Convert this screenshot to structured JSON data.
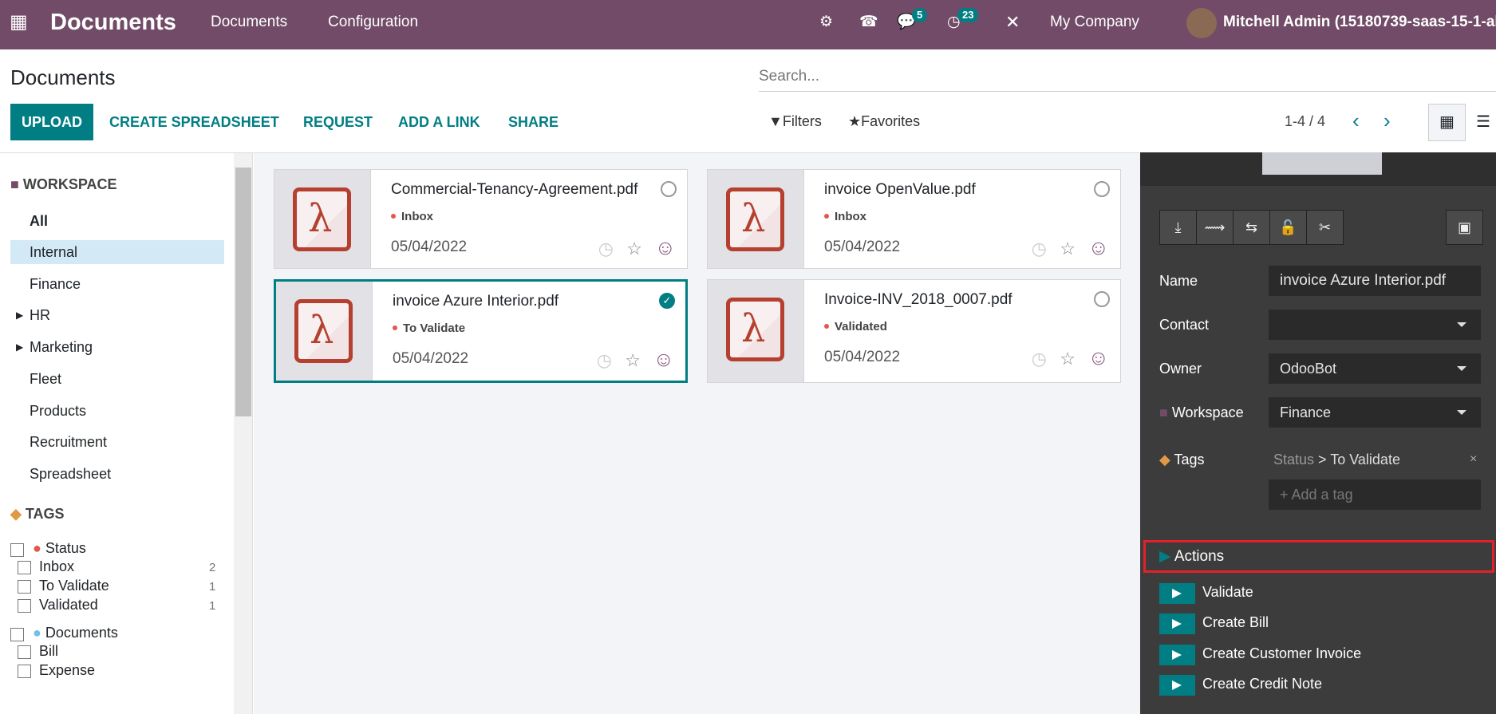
{
  "navbar": {
    "app_title": "Documents",
    "menu": [
      "Documents",
      "Configuration"
    ],
    "chat_count": "5",
    "activity_count": "23",
    "company": "My Company",
    "user": "Mitchell Admin (15180739-saas-15-1-al"
  },
  "control": {
    "title": "Documents",
    "search_placeholder": "Search...",
    "buttons": {
      "upload": "UPLOAD",
      "spreadsheet": "CREATE SPREADSHEET",
      "request": "REQUEST",
      "link": "ADD A LINK",
      "share": "SHARE"
    },
    "filters": "Filters",
    "favorites": "Favorites",
    "pager": "1-4 / 4"
  },
  "sidebar": {
    "workspace_header": "WORKSPACE",
    "workspaces": [
      {
        "label": "All"
      },
      {
        "label": "Internal"
      },
      {
        "label": "Finance"
      },
      {
        "label": "HR"
      },
      {
        "label": "Marketing"
      },
      {
        "label": "Fleet"
      },
      {
        "label": "Products"
      },
      {
        "label": "Recruitment"
      },
      {
        "label": "Spreadsheet"
      }
    ],
    "selected": "Finance",
    "tags_header": "TAGS",
    "tag_groups": [
      {
        "label": "Status",
        "color": "#e4574c",
        "tags": [
          {
            "label": "Inbox",
            "count": "2"
          },
          {
            "label": "To Validate",
            "count": "1"
          },
          {
            "label": "Validated",
            "count": "1"
          }
        ]
      },
      {
        "label": "Documents",
        "color": "#6cc1ed",
        "tags": [
          {
            "label": "Bill"
          },
          {
            "label": "Expense"
          }
        ]
      }
    ]
  },
  "documents": [
    {
      "name": "Commercial-Tenancy-Agreement.pdf",
      "tag": "Inbox",
      "date": "05/04/2022",
      "selected": false
    },
    {
      "name": "invoice OpenValue.pdf",
      "tag": "Inbox",
      "date": "05/04/2022",
      "selected": false
    },
    {
      "name": "invoice Azure Interior.pdf",
      "tag": "To Validate",
      "date": "05/04/2022",
      "selected": true
    },
    {
      "name": "Invoice-INV_2018_0007.pdf",
      "tag": "Validated",
      "date": "05/04/2022",
      "selected": false
    }
  ],
  "panel": {
    "name_label": "Name",
    "name_value": "invoice Azure Interior.pdf",
    "contact_label": "Contact",
    "contact_value": "",
    "owner_label": "Owner",
    "owner_value": "OdooBot",
    "workspace_label": "Workspace",
    "workspace_value": "Finance",
    "tags_label": "Tags",
    "tag_group": "Status",
    "tag_value": "> To Validate",
    "add_tag_placeholder": "+ Add a tag",
    "actions_label": "Actions",
    "actions": [
      "Validate",
      "Create Bill",
      "Create Customer Invoice",
      "Create Credit Note"
    ]
  },
  "colors": {
    "brand": "#714b67",
    "accent": "#017e84",
    "highlight": "#d3eaf6",
    "panel": "#3c3c3c",
    "annotation": "#e4202a"
  }
}
